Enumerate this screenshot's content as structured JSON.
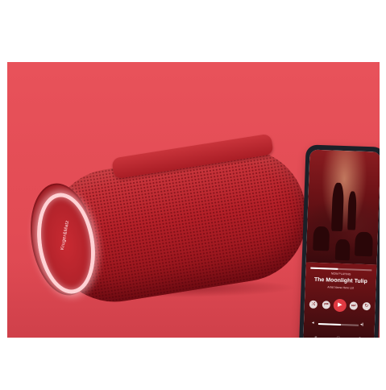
{
  "speaker": {
    "brand": "Kruger&Matz",
    "body_color": "#b82129",
    "ring_glow": "#ffd2d5"
  },
  "background": {
    "scene_color": "#e24b54",
    "page_color": "#ffffff"
  },
  "phone": {
    "player": {
      "now_playing_label": "NOW PLAYING",
      "song_title": "The Moonlight Tulip",
      "artist": "Artist Name Here Ltd",
      "progress": 0.45,
      "volume": 0.55,
      "controls": [
        "shuffle-icon",
        "previous-icon",
        "play-icon",
        "next-icon",
        "repeat-icon"
      ],
      "control_glyphs": {
        "shuffle": "⤨",
        "previous": "⏮",
        "play": "▶",
        "next": "⏭",
        "repeat": "↻",
        "vol_low": "◂",
        "vol_high": "◂)",
        "list": "≡",
        "heart": "♡",
        "share": "⇪"
      }
    }
  }
}
